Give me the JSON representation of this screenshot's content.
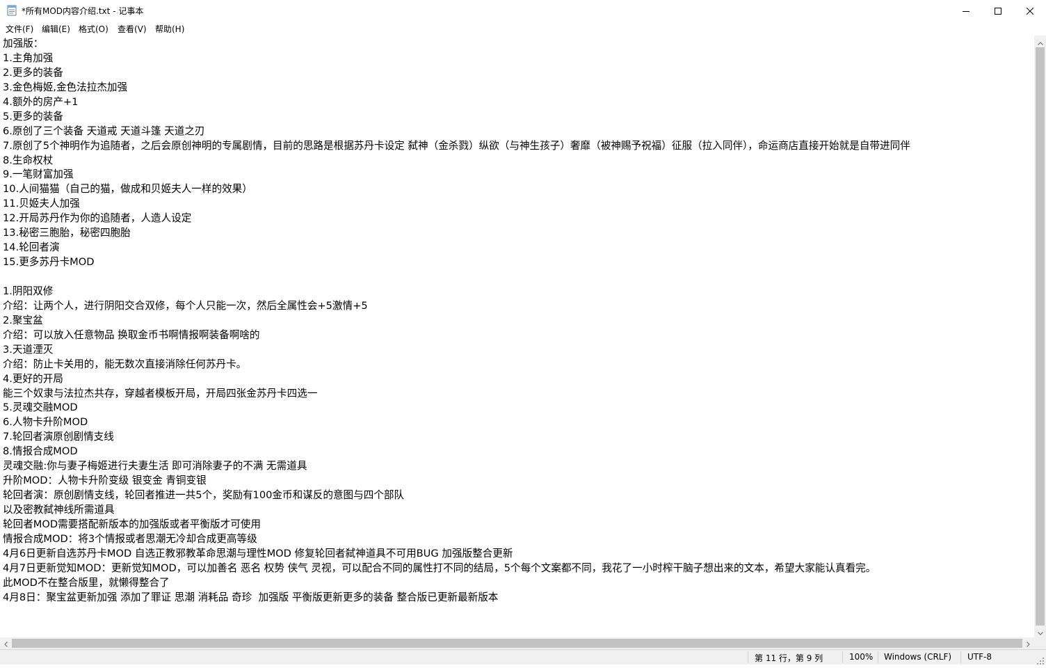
{
  "window": {
    "title": "*所有MOD内容介绍.txt - 记事本"
  },
  "menu": [
    {
      "label": "文件(F)"
    },
    {
      "label": "编辑(E)"
    },
    {
      "label": "格式(O)"
    },
    {
      "label": "查看(V)"
    },
    {
      "label": "帮助(H)"
    }
  ],
  "icons": {
    "app": "notepad-icon",
    "minimize": "minimize-icon",
    "maximize": "maximize-icon",
    "close": "close-icon"
  },
  "editor": {
    "lines": [
      "加强版：",
      "1.主角加强",
      "2.更多的装备",
      "3.金色梅姬,金色法拉杰加强",
      "4.额外的房产+1",
      "5.更多的装备",
      "6.原创了三个装备 天道戒 天道斗篷 天道之刃",
      "7.原创了5个神明作为追随者，之后会原创神明的专属剧情，目前的思路是根据苏丹卡设定 弑神（金杀戮）纵欲（与神生孩子）奢靡（被神赐予祝福）征服（拉入同伴），命运商店直接开始就是自带进同伴",
      "8.生命权杖",
      "9.一笔财富加强",
      "10.人间猫猫（自己的猫，做成和贝姬夫人一样的效果）",
      "11.贝姬夫人加强",
      "12.开局苏丹作为你的追随者，人造人设定",
      "13.秘密三胞胎，秘密四胞胎",
      "14.轮回者演",
      "15.更多苏丹卡MOD",
      "",
      "1.阴阳双修",
      "介绍：让两个人，进行阴阳交合双修，每个人只能一次，然后全属性会+5激情+5",
      "2.聚宝盆",
      "介绍：可以放入任意物品 换取金币书啊情报啊装备啊啥的",
      "3.天道湮灭",
      "介绍：防止卡关用的，能无数次直接消除任何苏丹卡。",
      "4.更好的开局",
      "能三个奴隶与法拉杰共存，穿越者模板开局，开局四张金苏丹卡四选一",
      "5.灵魂交融MOD",
      "6.人物卡升阶MOD",
      "7.轮回者演原创剧情支线",
      "8.情报合成MOD",
      "灵魂交融:你与妻子梅姬进行夫妻生活 即可消除妻子的不满 无需道具",
      "升阶MOD：人物卡升阶变级 银变金 青铜变银",
      "轮回者演：原创剧情支线，轮回者推进一共5个，奖励有100金币和谋反的意图与四个部队",
      "以及密教弑神线所需道具",
      "轮回者MOD需要搭配新版本的加强版或者平衡版才可使用",
      "情报合成MOD：将3个情报或者思潮无冷却合成更高等级",
      "4月6日更新自选苏丹卡MOD 自选正教邪教革命思潮与理性MOD 修复轮回者弑神道具不可用BUG 加强版整合更新",
      "4月7日更新觉知MOD：更新觉知MOD，可以加善名 恶名 权势 侠气 灵视，可以配合不同的属性打不同的结局，5个每个文案都不同，我花了一小时榨干脑子想出来的文本，希望大家能认真看完。",
      "此MOD不在整合版里，就懒得整合了",
      "4月8日：聚宝盆更新加强 添加了罪证 思潮 消耗品 奇珍  加强版 平衡版更新更多的装备 整合版已更新最新版本"
    ]
  },
  "status": {
    "position": "第 11 行，第 9 列",
    "zoom": "100%",
    "line_ending": "Windows (CRLF)",
    "encoding": "UTF-8"
  }
}
